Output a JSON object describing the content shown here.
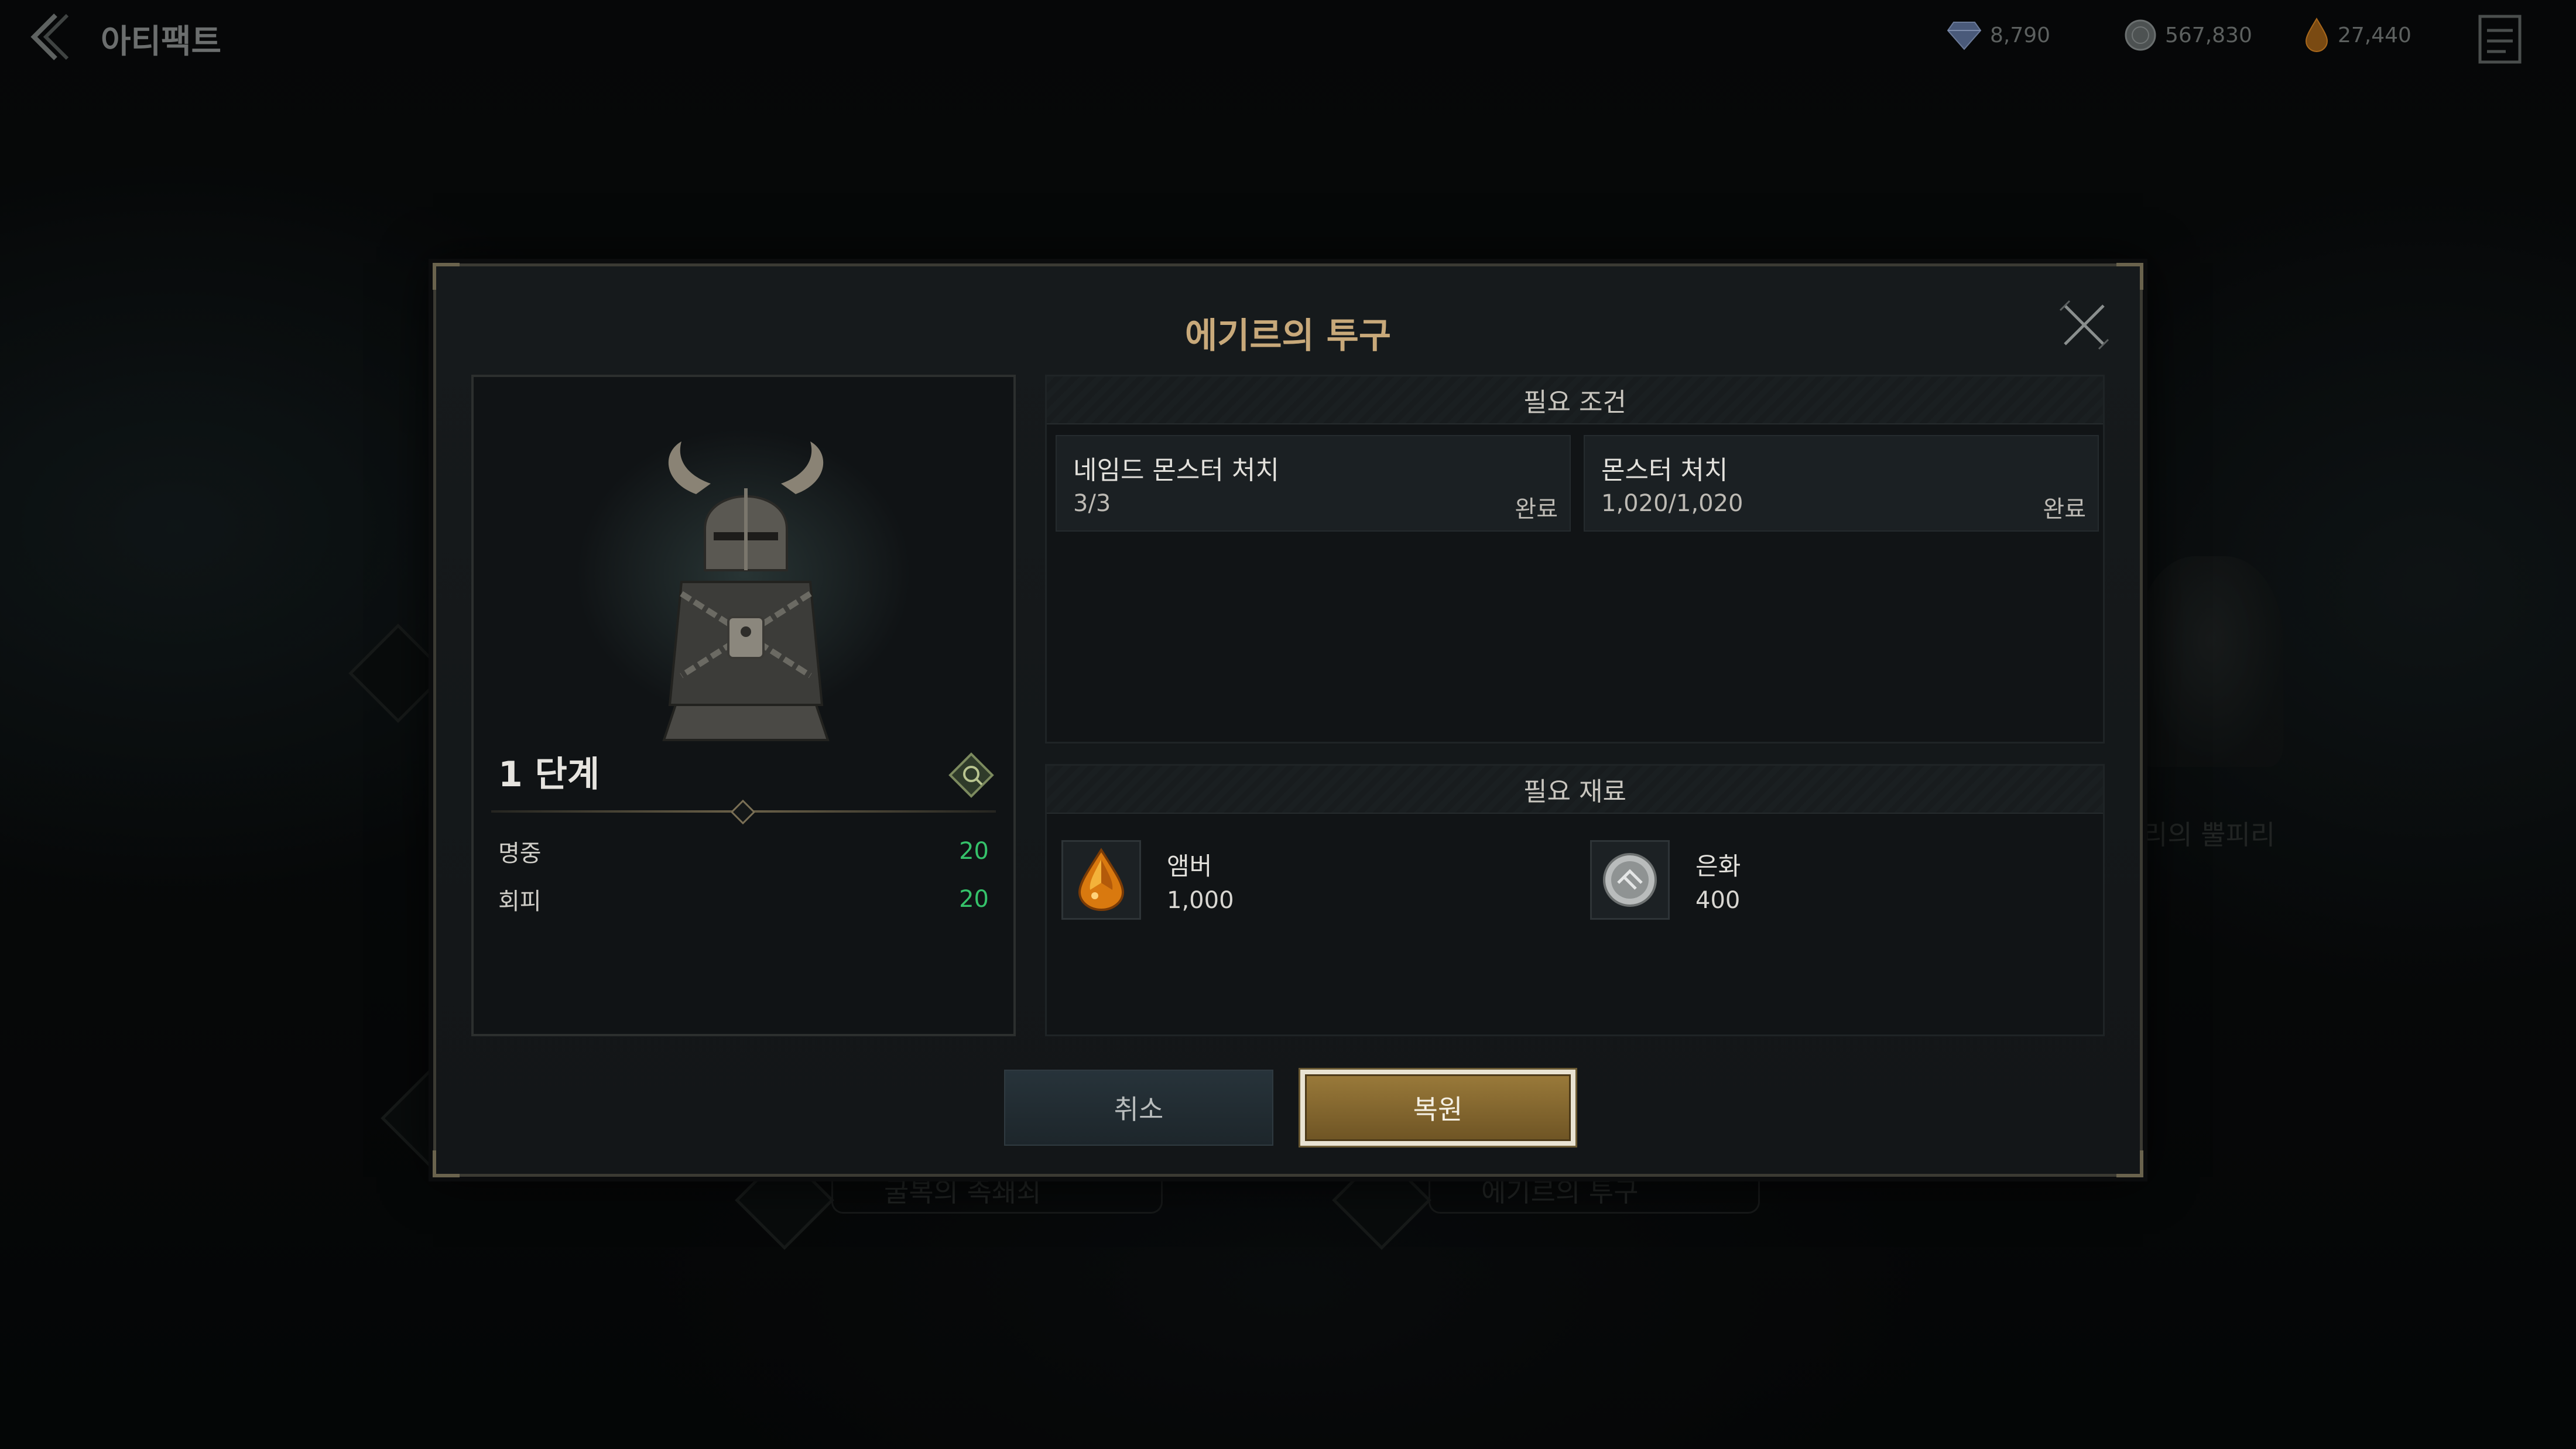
{
  "header": {
    "title": "아티팩트",
    "currencies": [
      {
        "icon": "diamond-icon",
        "value": "8,790"
      },
      {
        "icon": "silver-coin-icon",
        "value": "567,830"
      },
      {
        "icon": "amber-drop-icon",
        "value": "27,440"
      }
    ]
  },
  "background": {
    "labels": [
      "리의 뿔피리",
      "굴복의 족쇄쇠",
      "에기르의 투구"
    ]
  },
  "dialog": {
    "title": "에기르의 투구",
    "stage": "1 단계",
    "stats": [
      {
        "name": "명중",
        "value": "20"
      },
      {
        "name": "회피",
        "value": "20"
      }
    ],
    "requirements": {
      "header": "필요 조건",
      "items": [
        {
          "title": "네임드 몬스터 처치",
          "progress": "3/3",
          "status": "완료"
        },
        {
          "title": "몬스터 처치",
          "progress": "1,020/1,020",
          "status": "완료"
        }
      ]
    },
    "materials": {
      "header": "필요 재료",
      "items": [
        {
          "name": "앰버",
          "quantity": "1,000",
          "icon": "amber-gem-icon"
        },
        {
          "name": "은화",
          "quantity": "400",
          "icon": "silver-coin-icon"
        }
      ]
    },
    "buttons": {
      "cancel": "취소",
      "confirm": "복원"
    }
  },
  "colors": {
    "title_gold": "#c8a97a",
    "stat_green": "#35c26a",
    "confirm_gold": "#9a7a3a"
  }
}
